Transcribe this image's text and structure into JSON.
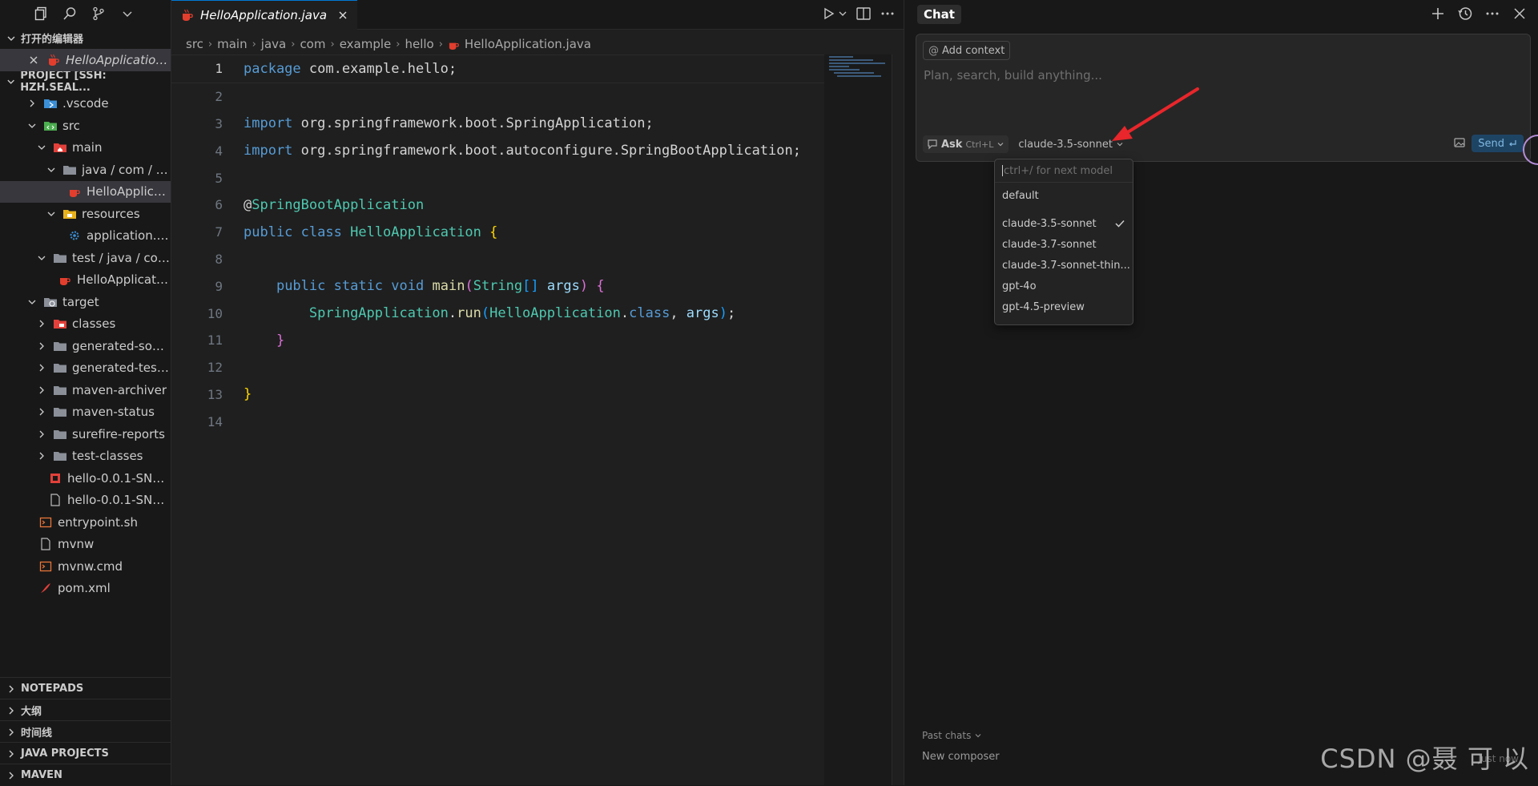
{
  "sidebar": {
    "open_editors_title": "打开的编辑器",
    "open_editor_file": "HelloApplication....",
    "project_title": "PROJECT [SSH: HZH.SEAL...",
    "tree": [
      {
        "label": ".vscode",
        "depth": 1,
        "kind": "vscode-folder-icon"
      },
      {
        "label": "src",
        "depth": 1,
        "kind": "src-folder-icon"
      },
      {
        "label": "main",
        "depth": 2,
        "kind": "main-folder-icon"
      },
      {
        "label": "java / com / exa...",
        "depth": 3,
        "kind": "folder-icon"
      },
      {
        "label": "HelloApplicati...",
        "depth": 4,
        "kind": "java-file-icon"
      },
      {
        "label": "resources",
        "depth": 3,
        "kind": "resources-folder-icon"
      },
      {
        "label": "application.pr...",
        "depth": 4,
        "kind": "settings-file-icon"
      },
      {
        "label": "test / java / com /...",
        "depth": 2,
        "kind": "folder-icon"
      },
      {
        "label": "HelloApplicatio...",
        "depth": 3,
        "kind": "java-file-icon"
      },
      {
        "label": "target",
        "depth": 1,
        "kind": "target-folder-icon"
      },
      {
        "label": "classes",
        "depth": 2,
        "kind": "classes-folder-icon"
      },
      {
        "label": "generated-sourc...",
        "depth": 2,
        "kind": "folder-icon"
      },
      {
        "label": "generated-test-s...",
        "depth": 2,
        "kind": "folder-icon"
      },
      {
        "label": "maven-archiver",
        "depth": 2,
        "kind": "folder-icon"
      },
      {
        "label": "maven-status",
        "depth": 2,
        "kind": "folder-icon"
      },
      {
        "label": "surefire-reports",
        "depth": 2,
        "kind": "folder-icon"
      },
      {
        "label": "test-classes",
        "depth": 2,
        "kind": "folder-icon"
      },
      {
        "label": "hello-0.0.1-SNA...",
        "depth": 2,
        "kind": "jar-file-icon"
      },
      {
        "label": "hello-0.0.1-SNA...",
        "depth": 2,
        "kind": "file-icon"
      },
      {
        "label": "entrypoint.sh",
        "depth": 1,
        "kind": "shell-file-icon"
      },
      {
        "label": "mvnw",
        "depth": 1,
        "kind": "file-icon"
      },
      {
        "label": "mvnw.cmd",
        "depth": 1,
        "kind": "shell-file-icon"
      },
      {
        "label": "pom.xml",
        "depth": 1,
        "kind": "xml-file-icon"
      }
    ],
    "bottom_sections": [
      "NOTEPADS",
      "大纲",
      "时间线",
      "JAVA PROJECTS",
      "MAVEN"
    ]
  },
  "editor": {
    "tab_label": "HelloApplication.java",
    "breadcrumb": [
      "src",
      "main",
      "java",
      "com",
      "example",
      "hello",
      "HelloApplication.java"
    ],
    "line_numbers": [
      "1",
      "2",
      "3",
      "4",
      "5",
      "6",
      "7",
      "8",
      "9",
      "10",
      "11",
      "12",
      "13",
      "14"
    ]
  },
  "chat": {
    "tab_label": "Chat",
    "add_context_label": "Add context",
    "placeholder": "Plan, search, build anything...",
    "ask_label": "Ask",
    "ask_shortcut": "Ctrl+L",
    "model_label": "claude-3.5-sonnet",
    "send_label": "Send",
    "model_menu": {
      "search_placeholder": "ctrl+/ for next model",
      "items": [
        "default",
        "claude-3.5-sonnet",
        "claude-3.7-sonnet",
        "claude-3.7-sonnet-thin...",
        "gpt-4o",
        "gpt-4.5-preview"
      ],
      "selected": "claude-3.5-sonnet"
    },
    "past_chats_label": "Past chats",
    "new_composer_label": "New composer",
    "just_now_label": "Just now"
  },
  "watermark": "CSDN @聂 可 以",
  "colors": {
    "accent": "#0078d4",
    "arrow": "#e8262b",
    "java_icon": "#e23e2e"
  }
}
